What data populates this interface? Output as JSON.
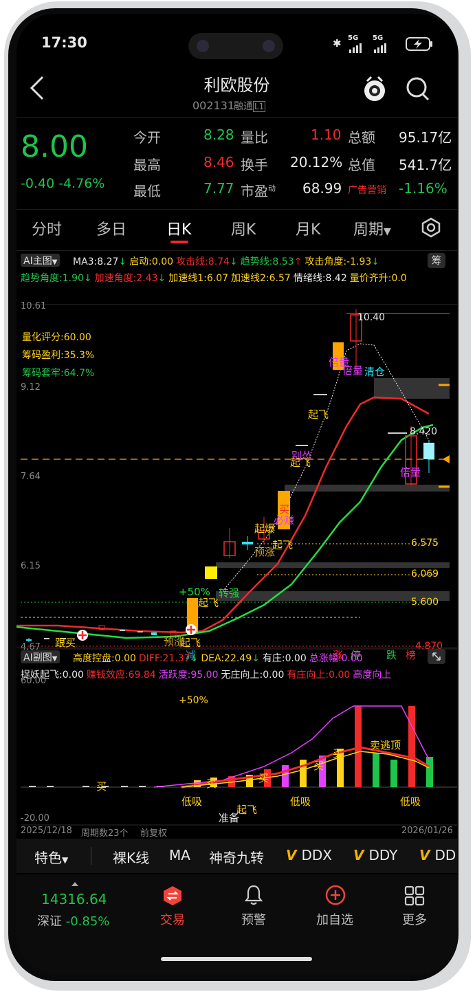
{
  "status_bar": {
    "time": "17:30",
    "net1": "5G",
    "net2": "5G"
  },
  "header": {
    "title": "利欧股份",
    "code": "002131",
    "badge1": "融",
    "badge2": "通",
    "badge3": "L1"
  },
  "quote": {
    "price": "8.00",
    "change": "-0.40",
    "change_pct": "-4.76%",
    "rows": [
      {
        "l1": "今开",
        "v1": "8.28",
        "l2": "量比",
        "v2": "1.10",
        "l3": "总额",
        "v3": "95.17亿"
      },
      {
        "l1": "最高",
        "v1": "8.46",
        "l2": "换手",
        "v2": "20.12%",
        "l3": "总值",
        "v3": "541.7亿"
      },
      {
        "l1": "最低",
        "v1": "7.77",
        "l2": "市盈",
        "v2": "68.99",
        "l3": "广告营销",
        "v3": "-1.16%"
      }
    ],
    "pe_sup": "动"
  },
  "tabs": [
    "分时",
    "多日",
    "日K",
    "周K",
    "月K",
    "周期"
  ],
  "main_indicator": {
    "name": "AI主图",
    "line1": [
      {
        "k": "MA3:",
        "v": "8.27",
        "c": "#e8e8e8",
        "arrow": "↓",
        "ac": "#1fc44a"
      },
      {
        "k": "启动:",
        "v": "0.00",
        "c": "#ffd21a",
        "arrow": "",
        "ac": ""
      },
      {
        "k": "攻击线:",
        "v": "8.74",
        "c": "#f12a2a",
        "arrow": "↓",
        "ac": "#1fc44a"
      },
      {
        "k": "趋势线:",
        "v": "8.53",
        "c": "#1fc44a",
        "arrow": "↑",
        "ac": "#f12a2a"
      },
      {
        "k": "攻击角度:",
        "v": "-1.93",
        "c": "#ffd21a",
        "arrow": "↓",
        "ac": "#1fc44a"
      }
    ],
    "line2": [
      {
        "k": "趋势角度:",
        "v": "1.90",
        "c": "#1fc44a",
        "arrow": "↓",
        "ac": "#1fc44a"
      },
      {
        "k": "加速角度:",
        "v": "2.43",
        "c": "#f12a2a",
        "arrow": "↓",
        "ac": "#1fc44a"
      },
      {
        "k": "加速线1:",
        "v": "6.07",
        "c": "#ffd21a",
        "arrow": "",
        "ac": ""
      },
      {
        "k": "加速线2:",
        "v": "6.57",
        "c": "#ffd21a",
        "arrow": "",
        "ac": ""
      },
      {
        "k": "情绪线:",
        "v": "8.42",
        "c": "#e8e8e8",
        "arrow": "",
        "ac": ""
      },
      {
        "k": "量价齐升:",
        "v": "0.0",
        "c": "#ffd21a",
        "arrow": "",
        "ac": ""
      }
    ],
    "chip_button": "筹"
  },
  "main_chart": {
    "axis_labels": [
      "10.61",
      "9.12",
      "7.64",
      "6.15",
      "4.67"
    ],
    "score": "量化评分:60.00",
    "profit": "筹码盈利:35.3%",
    "trapped": "筹码套牢:64.7%",
    "levels": [
      "6.575",
      "6.069",
      "5.600",
      "4.870"
    ],
    "high_label": "10.40",
    "last_label": "8.420",
    "markers": [
      "起飞",
      "起飞",
      "起飞",
      "起飞",
      "起爆",
      "预涨",
      "买",
      "必赚",
      "倍量",
      "清仓",
      "倍量",
      "别怂",
      "转强",
      "+50%",
      "跟买",
      "预涨",
      "起飞",
      "减",
      "涨",
      "停",
      "跌",
      "榜",
      "倍量"
    ]
  },
  "sub_indicator": {
    "name": "AI副图",
    "line1": [
      {
        "k": "高度控盘:",
        "v": "0.00",
        "c": "#ffd21a",
        "arrow": ""
      },
      {
        "k": "DIFF:",
        "v": "21.37",
        "c": "#f12a2a",
        "arrow": "↓"
      },
      {
        "k": "DEA:",
        "v": "22.49",
        "c": "#ffd21a",
        "arrow": "↓"
      },
      {
        "k": "有庄:",
        "v": "0.00",
        "c": "#e8e8e8",
        "arrow": ""
      },
      {
        "k": "总涨幅:",
        "v": "0.00",
        "c": "#e040ff",
        "arrow": ""
      }
    ],
    "line2": [
      {
        "k": "捉妖起飞:",
        "v": "0.00",
        "c": "#e8e8e8"
      },
      {
        "k": "赚钱效应:",
        "v": "69.84",
        "c": "#f12a2a"
      },
      {
        "k": "活跃度:",
        "v": "95.00",
        "c": "#e040ff"
      },
      {
        "k": "无庄向上:",
        "v": "0.00",
        "c": "#e8e8e8"
      },
      {
        "k": "有庄向上:",
        "v": "0.00",
        "c": "#f12a2a"
      },
      {
        "k": "高度向上",
        "v": "",
        "c": "#e040ff"
      }
    ],
    "axis_top": "60.00",
    "axis_bottom": "-20.00",
    "plus50": "+50%",
    "markers": [
      "低吸",
      "低吸",
      "低吸",
      "准备",
      "起飞",
      "卖逃顶",
      "买",
      "买",
      "买",
      "买",
      "买"
    ]
  },
  "footer_info": {
    "start": "2025/12/18",
    "cycles": "周期数23个",
    "adj": "前复权",
    "end": "2026/01/26"
  },
  "indicator_bar": [
    "特色",
    "裸K线",
    "MA",
    "神奇九转",
    "DDX",
    "DDY",
    "DD"
  ],
  "bottom_nav": {
    "index_value": "14316.64",
    "index_name": "深证",
    "index_pct": "-0.85%",
    "items": [
      "交易",
      "预警",
      "加自选",
      "更多"
    ]
  }
}
